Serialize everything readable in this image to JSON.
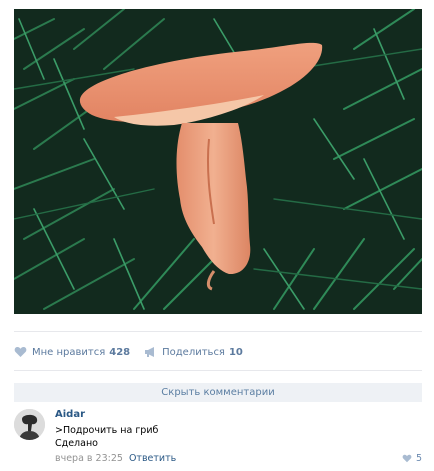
{
  "post": {
    "photo_icon": "mushroom-photo"
  },
  "actions": {
    "like_label": "Мне нравится",
    "like_count": "428",
    "share_label": "Поделиться",
    "share_count": "10"
  },
  "comments": {
    "hide_label": "Скрыть комментарии",
    "items": [
      {
        "author": "Aidar",
        "line1": ">Подрочить на гриб",
        "line2": "Сделано",
        "time": "вчера в 23:25",
        "reply_label": "Ответить",
        "likes": "5"
      }
    ]
  },
  "colors": {
    "accent": "#5c7a9e",
    "link": "#2a5885",
    "mushroom": "#e79a78",
    "grass": "#1f5e3a"
  }
}
